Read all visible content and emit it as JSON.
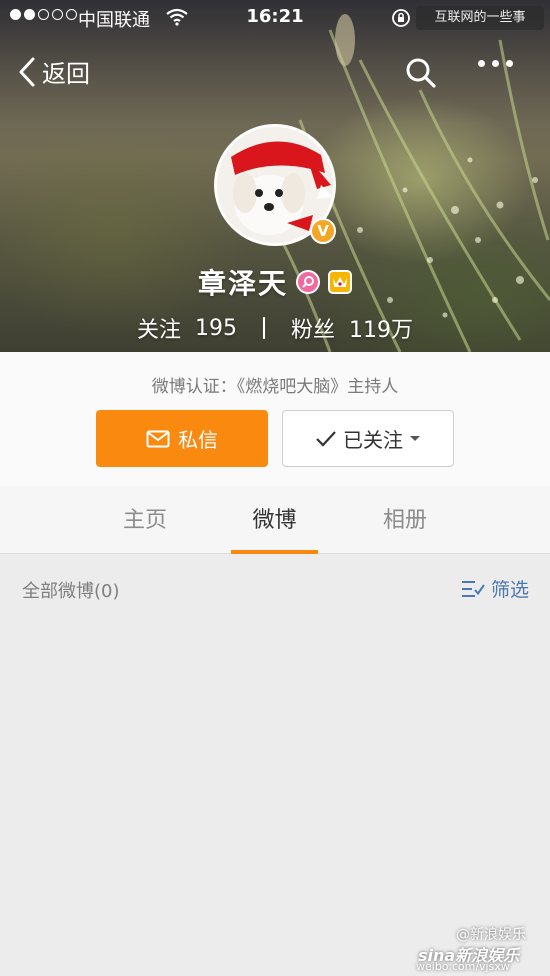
{
  "status_bar": {
    "carrier": "中国联通",
    "time": "16:21",
    "watermark_text": "互联网的一些事"
  },
  "nav": {
    "back_label": "返回",
    "search_icon": "search-icon",
    "more_icon": "more-dots-icon"
  },
  "profile": {
    "name": "章泽天",
    "following_label": "关注",
    "following_count": "195",
    "fans_label": "粉丝",
    "fans_count": "119万",
    "verified_badge": "V",
    "verification": "微博认证：《燃烧吧大脑》主持人"
  },
  "actions": {
    "message_label": "私信",
    "follow_label": "已关注"
  },
  "tabs": [
    {
      "label": "主页",
      "active": false
    },
    {
      "label": "微博",
      "active": true
    },
    {
      "label": "相册",
      "active": false
    }
  ],
  "feed": {
    "all_label": "全部微博(0)",
    "filter_label": "筛选"
  },
  "watermark": {
    "handle": "@新浪娱乐",
    "brand": "sina新浪娱乐",
    "url": "weibo.com/vjsxw"
  },
  "colors": {
    "accent_orange": "#f98a0f",
    "link_blue": "#4c78b2",
    "verified_gold": "#f5a623"
  }
}
